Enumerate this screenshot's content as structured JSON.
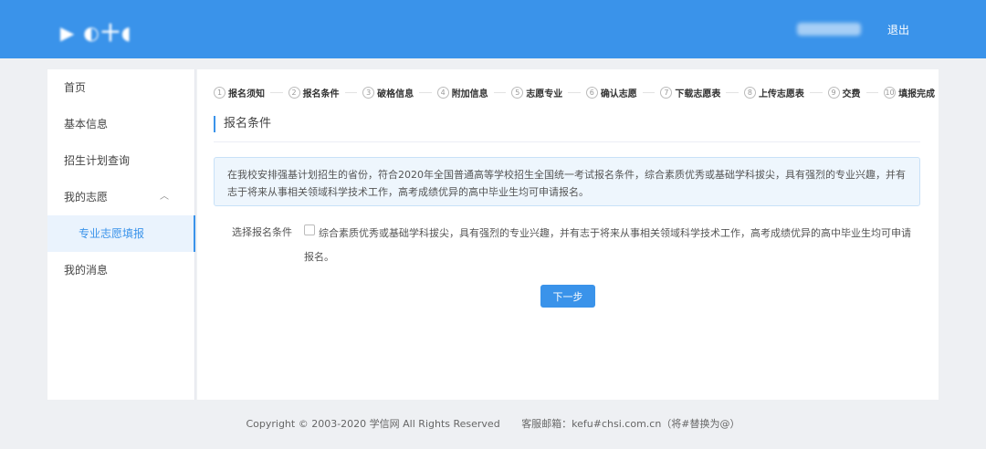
{
  "header": {
    "logo_text": "",
    "logout_label": "退出"
  },
  "sidebar": {
    "items": [
      {
        "label": "首页"
      },
      {
        "label": "基本信息"
      },
      {
        "label": "招生计划查询"
      },
      {
        "label": "我的志愿"
      },
      {
        "label": "专业志愿填报"
      },
      {
        "label": "我的消息"
      }
    ]
  },
  "steps": [
    {
      "num": "1",
      "label": "报名须知"
    },
    {
      "num": "2",
      "label": "报名条件"
    },
    {
      "num": "3",
      "label": "破格信息"
    },
    {
      "num": "4",
      "label": "附加信息"
    },
    {
      "num": "5",
      "label": "志愿专业"
    },
    {
      "num": "6",
      "label": "确认志愿"
    },
    {
      "num": "7",
      "label": "下载志愿表"
    },
    {
      "num": "8",
      "label": "上传志愿表"
    },
    {
      "num": "9",
      "label": "交费"
    },
    {
      "num": "10",
      "label": "填报完成"
    }
  ],
  "main": {
    "section_title": "报名条件",
    "notice": "在我校安排强基计划招生的省份，符合2020年全国普通高等学校招生全国统一考试报名条件，综合素质优秀或基础学科拔尖，具有强烈的专业兴趣，并有志于将来从事相关领域科学技术工作，高考成绩优异的高中毕业生均可申请报名。",
    "condition_label": "选择报名条件",
    "condition_text": "综合素质优秀或基础学科拔尖，具有强烈的专业兴趣，并有志于将来从事相关领域科学技术工作，高考成绩优异的高中毕业生均可申请报名。",
    "next_button": "下一步"
  },
  "footer": {
    "copyright": "Copyright © 2003-2020 学信网 All Rights Reserved",
    "email": "客服邮箱：kefu#chsi.com.cn（将#替换为@）"
  },
  "colors": {
    "brand": "#3a93ea"
  }
}
